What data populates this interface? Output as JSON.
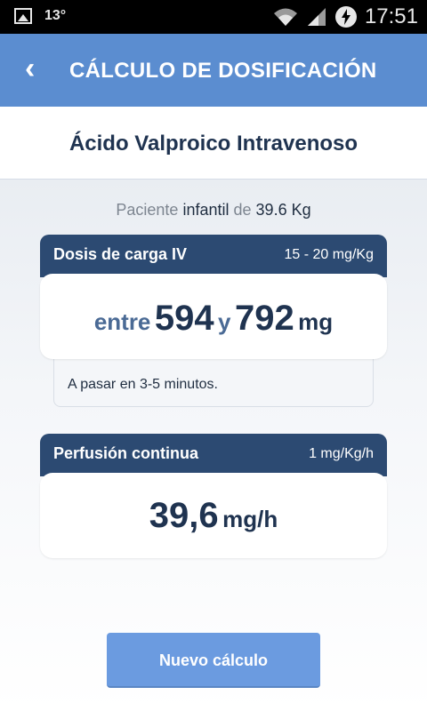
{
  "status_bar": {
    "temperature": "13°",
    "time": "17:51",
    "icons": [
      "image-icon",
      "wifi-icon",
      "signal-icon",
      "power-icon"
    ]
  },
  "header": {
    "back_icon": "‹",
    "title": "CÁLCULO DE DOSIFICACIÓN"
  },
  "drug": {
    "title": "Ácido Valproico Intravenoso"
  },
  "patient": {
    "prefix": "Paciente",
    "type": "infantil",
    "connector": "de",
    "weight": "39.6 Kg"
  },
  "loading_dose": {
    "label": "Dosis de carga IV",
    "range": "15 - 20 mg/Kg",
    "word_between": "entre",
    "min": "594",
    "word_and": "y",
    "max": "792",
    "unit": "mg",
    "note": "A pasar en 3-5 minutos."
  },
  "infusion": {
    "label": "Perfusión continua",
    "rate": "1 mg/Kg/h",
    "value": "39,6",
    "unit": "mg/h"
  },
  "actions": {
    "new_calc": "Nuevo cálculo"
  },
  "colors": {
    "header": "#5b8dd0",
    "card_header": "#2c4a72",
    "button": "#6b9be0",
    "text_dark": "#1f3350"
  }
}
